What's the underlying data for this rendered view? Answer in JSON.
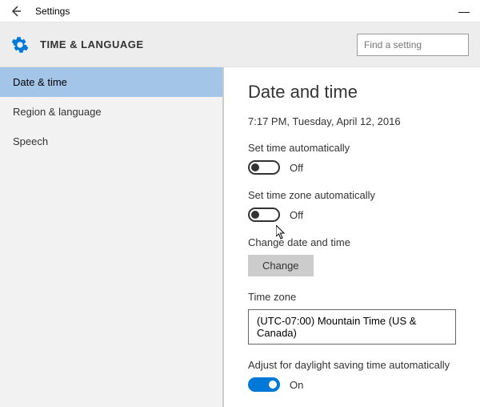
{
  "window": {
    "title": "Settings"
  },
  "header": {
    "category": "TIME & LANGUAGE",
    "search_placeholder": "Find a setting"
  },
  "sidebar": {
    "items": [
      {
        "label": "Date & time",
        "active": true
      },
      {
        "label": "Region & language",
        "active": false
      },
      {
        "label": "Speech",
        "active": false
      }
    ]
  },
  "main": {
    "title": "Date and time",
    "current_datetime": "7:17 PM, Tuesday, April 12, 2016",
    "set_time_auto": {
      "label": "Set time automatically",
      "state": "Off",
      "on": false
    },
    "set_tz_auto": {
      "label": "Set time zone automatically",
      "state": "Off",
      "on": false
    },
    "change_dt": {
      "label": "Change date and time",
      "button": "Change"
    },
    "timezone": {
      "label": "Time zone",
      "value": "(UTC-07:00) Mountain Time (US & Canada)"
    },
    "dst": {
      "label": "Adjust for daylight saving time automatically",
      "state": "On",
      "on": true
    }
  }
}
